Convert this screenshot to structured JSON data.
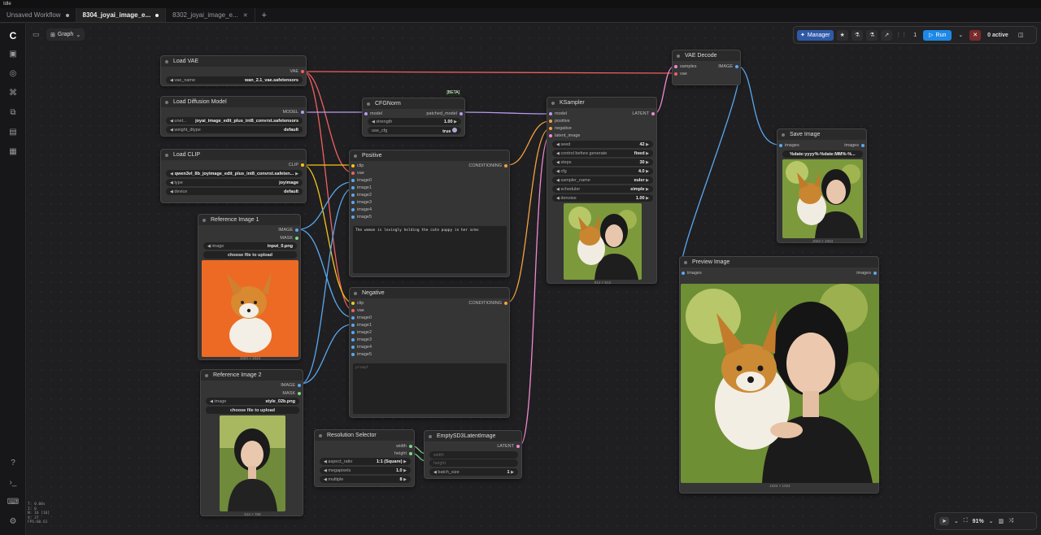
{
  "app": {
    "title": "Idle"
  },
  "tabs": [
    {
      "label": "Unsaved Workflow"
    },
    {
      "label": "8304_joyai_image_e..."
    },
    {
      "label": "8302_joyai_image_e..."
    }
  ],
  "toolbar": {
    "graph_label": "Graph",
    "manager_label": "Manager",
    "queue_count": "1",
    "run_label": "Run",
    "active_label": "0 active"
  },
  "colors": {
    "clip": "#f5c518",
    "vae": "#f06060",
    "model": "#b79cf0",
    "conditioning": "#f5a040",
    "image": "#5aa8f0",
    "latent": "#f08ad0",
    "int": "#7ed98a"
  },
  "nodes": {
    "load_vae": {
      "title": "Load VAE",
      "out": "VAE",
      "w_name": "vae_name",
      "w_value": "wan_2.1_vae.safetensors"
    },
    "load_diffusion": {
      "title": "Load Diffusion Model",
      "out": "MODEL",
      "w1_name": "unet...",
      "w1_value": "joyai_image_edit_plus_int8_convrst.safetensors",
      "w2_name": "weight_dtype",
      "w2_value": "default"
    },
    "load_clip": {
      "title": "Load CLIP",
      "out": "CLIP",
      "w1_value": "qwen3vl_8b_joyimage_edit_plus_int8_convrst.safeten...",
      "w2_name": "type",
      "w2_value": "joyimage",
      "w3_name": "device",
      "w3_value": "default"
    },
    "cfgnorm": {
      "title": "CFGNorm",
      "beta": "[BETA]",
      "in": "model",
      "out": "patched_model",
      "w1_name": "strength",
      "w1_value": "1.00",
      "w2_name": "use_cfg",
      "w2_value": "true"
    },
    "positive": {
      "title": "Positive",
      "inputs": [
        "clip",
        "vae",
        "image0",
        "image1",
        "image2",
        "image3",
        "image4",
        "image5"
      ],
      "out": "CONDITIONING",
      "text": "The woman is lovingly holding the cute puppy in her arms"
    },
    "negative": {
      "title": "Negative",
      "inputs": [
        "clip",
        "vae",
        "image0",
        "image1",
        "image2",
        "image3",
        "image4",
        "image5"
      ],
      "out": "CONDITIONING",
      "placeholder": "prompt"
    },
    "ksampler": {
      "title": "KSampler",
      "inputs": [
        "model",
        "positive",
        "negative",
        "latent_image"
      ],
      "out": "LATENT",
      "widgets": [
        {
          "name": "seed",
          "value": "42"
        },
        {
          "name": "control before generate",
          "value": "fixed"
        },
        {
          "name": "steps",
          "value": "30"
        },
        {
          "name": "cfg",
          "value": "4.0"
        },
        {
          "name": "sampler_name",
          "value": "euler"
        },
        {
          "name": "scheduler",
          "value": "simple"
        },
        {
          "name": "denoise",
          "value": "1.00"
        }
      ],
      "caption": "512 × 512"
    },
    "vae_decode": {
      "title": "VAE Decode",
      "in1": "samples",
      "in2": "vae",
      "out": "IMAGE"
    },
    "save_image": {
      "title": "Save Image",
      "in": "images",
      "out": "images",
      "w_value": "%date:yyyy%-%date:MM%-%...",
      "caption": "1024 × 1024"
    },
    "preview_image": {
      "title": "Preview Image",
      "in": "images",
      "out": "images",
      "caption": "1024 × 1024"
    },
    "ref1": {
      "title": "Reference Image 1",
      "out1": "IMAGE",
      "out2": "MASK",
      "w_name": "image",
      "w_value": "input_0.png",
      "btn": "choose file to upload",
      "caption": "1024 × 1024"
    },
    "ref2": {
      "title": "Reference Image 2",
      "out1": "IMAGE",
      "out2": "MASK",
      "w_name": "image",
      "w_value": "style_02b.png",
      "btn": "choose file to upload",
      "caption": "512 × 768"
    },
    "resolution": {
      "title": "Resolution Selector",
      "out1": "width",
      "out2": "height",
      "widgets": [
        {
          "name": "aspect_ratio",
          "value": "1:1 (Square)"
        },
        {
          "name": "megapixels",
          "value": "1.0"
        },
        {
          "name": "multiple",
          "value": "8"
        }
      ]
    },
    "empty_latent": {
      "title": "EmptySD3LatentImage",
      "out": "LATENT",
      "in1": "width",
      "in2": "height",
      "w_name": "batch_size",
      "w_value": "1"
    }
  },
  "status": {
    "lines": [
      "T: 0.00s",
      "I: 0",
      "N: 16 [16]",
      "V: 37",
      "FPS:60.61"
    ]
  },
  "bottom": {
    "zoom": "91%"
  }
}
